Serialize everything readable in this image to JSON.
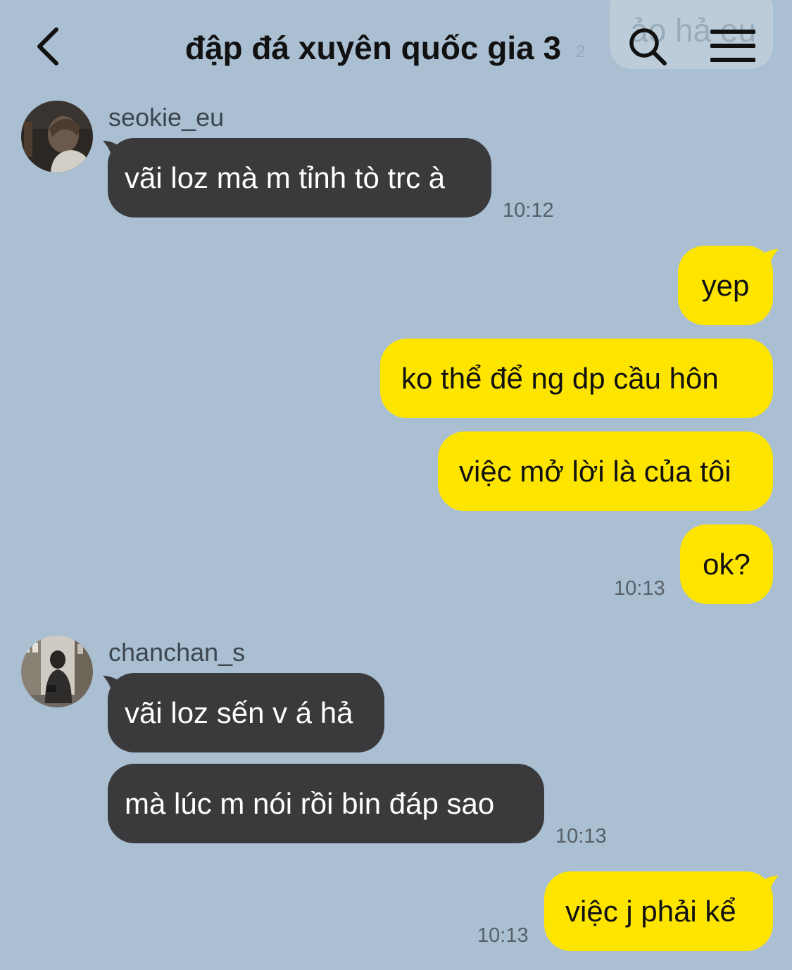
{
  "header": {
    "title": "đập đá xuyên quốc gia 3",
    "back_icon": "chevron-left-icon",
    "search_icon": "search-icon",
    "menu_icon": "hamburger-menu-icon",
    "ghost_bubble_text": "ảo hả eu",
    "ghost_time": "2"
  },
  "colors": {
    "background": "#aabfd2",
    "incoming_bubble": "#3a3a3c",
    "outgoing_bubble": "#fee500"
  },
  "messages": [
    {
      "sender": "seokie_eu",
      "avatar": "user-avatar",
      "texts": [
        "vãi loz mà m tỉnh tò trc à"
      ],
      "time": "10:12"
    },
    {
      "sender": "me",
      "texts": [
        "yep",
        "ko thể để ng dp cầu hôn",
        "việc mở lời là của tôi",
        "ok?"
      ],
      "time": "10:13"
    },
    {
      "sender": "chanchan_s",
      "avatar": "user-avatar",
      "texts": [
        "vãi loz sến v á hả",
        "mà lúc m nói rồi bin đáp sao"
      ],
      "time": "10:13"
    },
    {
      "sender": "me",
      "texts": [
        "việc j phải kể"
      ],
      "time": "10:13"
    }
  ]
}
